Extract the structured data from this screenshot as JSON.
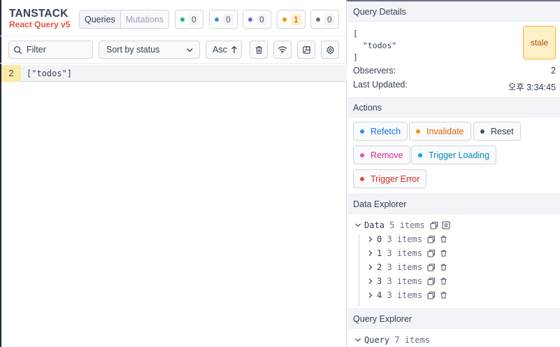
{
  "brand": {
    "line1": "TANSTACK",
    "line2": "React Query v5"
  },
  "view_toggle": {
    "queries": "Queries",
    "mutations": "Mutations"
  },
  "status_counts": [
    {
      "status": "fresh",
      "color": "#12b76a",
      "count": "0"
    },
    {
      "status": "fetching",
      "color": "#2e90fa",
      "count": "0"
    },
    {
      "status": "paused",
      "color": "#7a5af8",
      "count": "0"
    },
    {
      "status": "stale",
      "color": "#f79009",
      "count": "1"
    },
    {
      "status": "inactive",
      "color": "#667085",
      "count": "0"
    }
  ],
  "toolbar": {
    "filter_placeholder": "Filter",
    "sort_label": "Sort by status",
    "order_label": "Asc",
    "icons": [
      "trash-icon",
      "wifi-icon",
      "open-external-icon",
      "settings-icon"
    ]
  },
  "query_list": [
    {
      "observers": "2",
      "key": "[\"todos\"]"
    }
  ],
  "details": {
    "title": "Query Details",
    "key_line1": "[",
    "key_line2": "  \"todos\"",
    "key_line3": "]",
    "status": "stale",
    "observers_label": "Observers:",
    "observers_value": "2",
    "updated_label": "Last Updated:",
    "updated_value": "오후 3:34:45"
  },
  "actions": {
    "title": "Actions",
    "buttons": [
      {
        "label": "Refetch",
        "color": "#2e90fa",
        "text_color": "#1570ef"
      },
      {
        "label": "Invalidate",
        "color": "#f79009",
        "text_color": "#dc6803"
      },
      {
        "label": "Reset",
        "color": "#475467",
        "text_color": "#344054"
      },
      {
        "label": "Remove",
        "color": "#ee46bc",
        "text_color": "#dd2590"
      },
      {
        "label": "Trigger Loading",
        "color": "#06aed4",
        "text_color": "#088ab2"
      },
      {
        "label": "Trigger Error",
        "color": "#f04438",
        "text_color": "#d92d20"
      }
    ]
  },
  "data_explorer": {
    "title": "Data Explorer",
    "root_label": "Data",
    "root_meta": "5 items",
    "children": [
      {
        "key": "0",
        "meta": "3 items"
      },
      {
        "key": "1",
        "meta": "3 items"
      },
      {
        "key": "2",
        "meta": "3 items"
      },
      {
        "key": "3",
        "meta": "3 items"
      },
      {
        "key": "4",
        "meta": "3 items"
      }
    ]
  },
  "query_explorer": {
    "title": "Query Explorer",
    "root_label": "Query",
    "root_meta": "7 items"
  }
}
